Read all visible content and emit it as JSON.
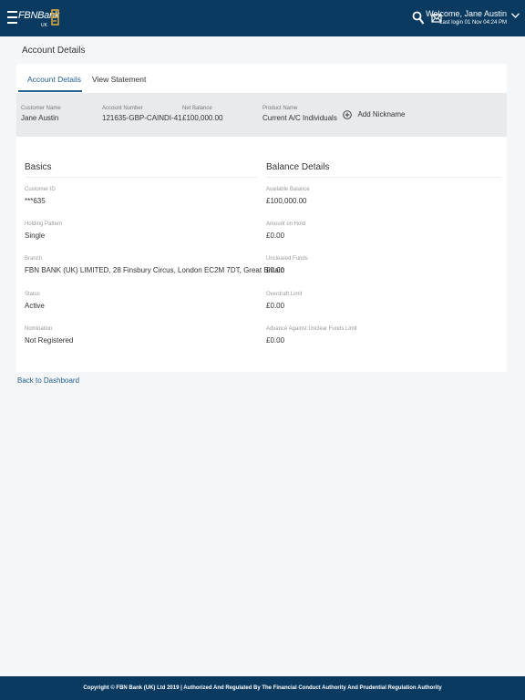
{
  "header": {
    "logo_text": "FBNBank",
    "logo_sub": "UK",
    "welcome": "Welcome, Jane Austin",
    "last_login": "Last login 01 Nov 04:24 PM"
  },
  "page_title": "Account Details",
  "tabs": [
    {
      "label": "Account Details",
      "active": true
    },
    {
      "label": "View Statement",
      "active": false
    }
  ],
  "summary": {
    "customer_name": {
      "label": "Customer Name",
      "value": "Jane Austin"
    },
    "account_number": {
      "label": "Account Number",
      "value": "121635-GBP-CAINDI-41"
    },
    "net_balance": {
      "label": "Net Balance",
      "value": "£100,000.00"
    },
    "product_name": {
      "label": "Product Name",
      "value": "Current A/C Individuals"
    },
    "add_nickname": "Add Nickname"
  },
  "basics": {
    "title": "Basics",
    "fields": [
      {
        "label": "Customer ID",
        "value": "***635"
      },
      {
        "label": "Holding Pattern",
        "value": "Single"
      },
      {
        "label": "Branch",
        "value": "FBN BANK (UK) LIMITED, 28 Finsbury Circus, London EC2M 7DT, Great Britain"
      },
      {
        "label": "Status",
        "value": "Active"
      },
      {
        "label": "Nomination",
        "value": "Not Registered"
      }
    ]
  },
  "balance_details": {
    "title": "Balance Details",
    "fields": [
      {
        "label": "Available Balance",
        "value": "£100,000.00"
      },
      {
        "label": "Amount on Hold",
        "value": "£0.00"
      },
      {
        "label": "Uncleared Funds",
        "value": "£0.00"
      },
      {
        "label": "Overdraft Limit",
        "value": "£0.00"
      },
      {
        "label": "Advance Against Unclear Funds Limit",
        "value": "£0.00"
      }
    ]
  },
  "back_link": "Back to Dashboard",
  "footer": "Copyright © FBN Bank (UK) Ltd 2019 | Authorized And Regulated By The Financial Conduct Authority And Prudential Regulation Authority",
  "colors": {
    "header_bg": "#0a3a60",
    "accent": "#245f8e",
    "logo_gold": "#e8b33a"
  },
  "icons": [
    "hamburger-icon",
    "search-icon",
    "mail-icon",
    "chevron-down-icon",
    "plus-circle-icon"
  ]
}
